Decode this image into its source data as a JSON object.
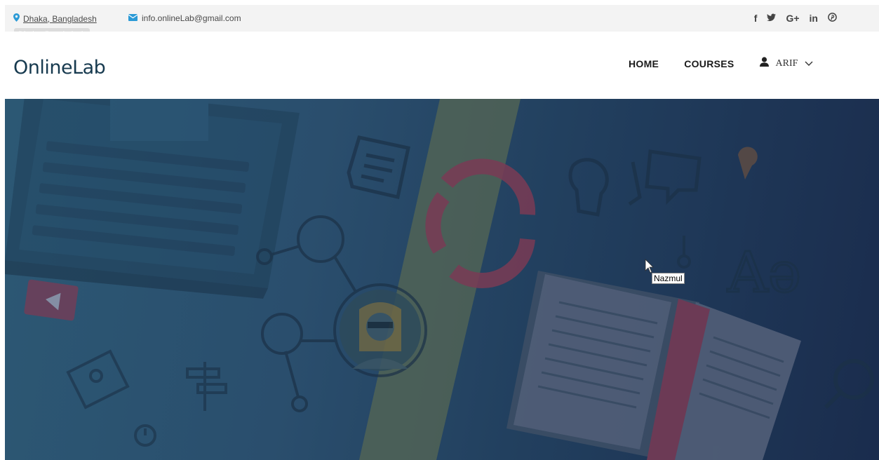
{
  "topbar": {
    "location": "Dhaka, Bangladesh",
    "email": "info.onlineLab@gmail.com",
    "tooltip": "Dhaka, Bangladesh",
    "social": [
      "f",
      "y",
      "G+",
      "in",
      "p"
    ]
  },
  "header": {
    "logo": "OnlineLab",
    "nav": {
      "home": "HOME",
      "courses": "COURSES",
      "user": "ARIF"
    }
  },
  "hero": {
    "cursor_label": "Nazmul"
  },
  "colors": {
    "accent_blue": "#2b9ad6",
    "logo": "#173a4f",
    "hero_dark": "#1a2c4d"
  }
}
